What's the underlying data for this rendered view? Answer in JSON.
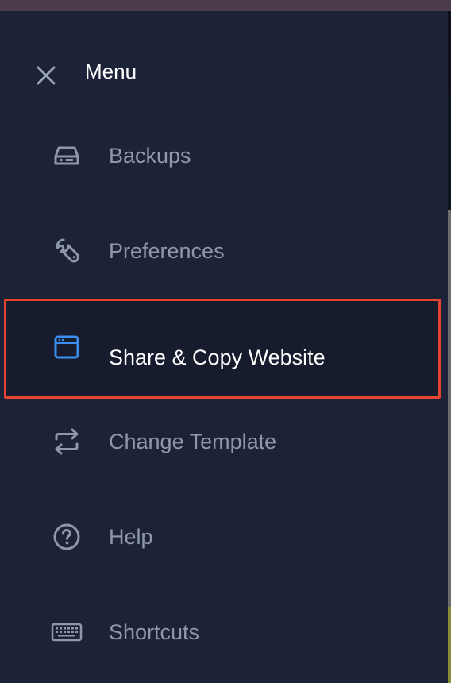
{
  "menu": {
    "title": "Menu",
    "close_icon": "close-icon",
    "items": [
      {
        "label": "Backups",
        "icon": "drive-icon",
        "active": false
      },
      {
        "label": "Preferences",
        "icon": "wrench-icon",
        "active": false
      },
      {
        "label": "Share & Copy Website",
        "icon": "browser-window-icon",
        "active": true
      },
      {
        "label": "Change Template",
        "icon": "swap-arrows-icon",
        "active": false
      },
      {
        "label": "Help",
        "icon": "help-circle-icon",
        "active": false
      },
      {
        "label": "Shortcuts",
        "icon": "keyboard-icon",
        "active": false
      }
    ]
  },
  "colors": {
    "panel_bg": "#1c2237",
    "item_text": "#8e97ac",
    "active_text": "#ffffff",
    "active_icon": "#3d8ef0",
    "highlight_border": "#e5452f"
  }
}
